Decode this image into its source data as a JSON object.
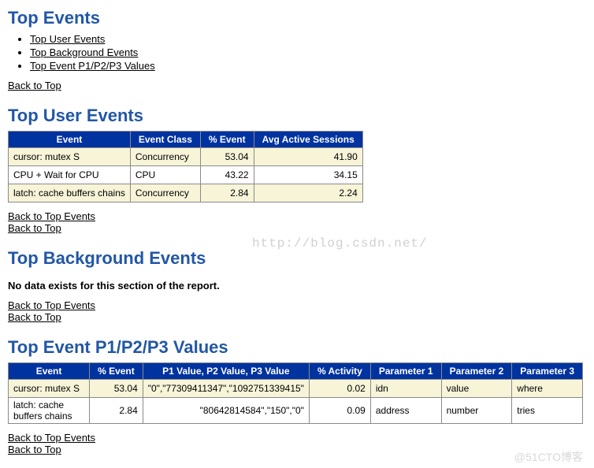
{
  "header": {
    "title": "Top Events"
  },
  "toc": {
    "items": [
      "Top User Events",
      "Top Background Events",
      "Top Event P1/P2/P3 Values"
    ]
  },
  "nav": {
    "back_to_top": "Back to Top",
    "back_to_top_events": "Back to Top Events"
  },
  "sections": {
    "user_events": {
      "title": "Top User Events",
      "columns": [
        "Event",
        "Event Class",
        "% Event",
        "Avg Active Sessions"
      ],
      "rows": [
        {
          "event": "cursor: mutex S",
          "class": "Concurrency",
          "pct": "53.04",
          "avg": "41.90"
        },
        {
          "event": "CPU + Wait for CPU",
          "class": "CPU",
          "pct": "43.22",
          "avg": "34.15"
        },
        {
          "event": "latch: cache buffers chains",
          "class": "Concurrency",
          "pct": "2.84",
          "avg": "2.24"
        }
      ]
    },
    "bg_events": {
      "title": "Top Background Events",
      "nodata": "No data exists for this section of the report."
    },
    "p_values": {
      "title": "Top Event P1/P2/P3 Values",
      "columns": [
        "Event",
        "% Event",
        "P1 Value, P2 Value, P3 Value",
        "% Activity",
        "Parameter 1",
        "Parameter 2",
        "Parameter 3"
      ],
      "rows": [
        {
          "event": "cursor: mutex S",
          "pct": "53.04",
          "pvals": "\"0\",\"77309411347\",\"1092751339415\"",
          "activity": "0.02",
          "p1": "idn",
          "p2": "value",
          "p3": "where"
        },
        {
          "event": "latch: cache buffers chains",
          "pct": "2.84",
          "pvals": "\"80642814584\",\"150\",\"0\"",
          "activity": "0.09",
          "p1": "address",
          "p2": "number",
          "p3": "tries"
        }
      ]
    }
  },
  "watermark": {
    "url": "http://blog.csdn.net/",
    "brand": "@51CTO博客"
  }
}
